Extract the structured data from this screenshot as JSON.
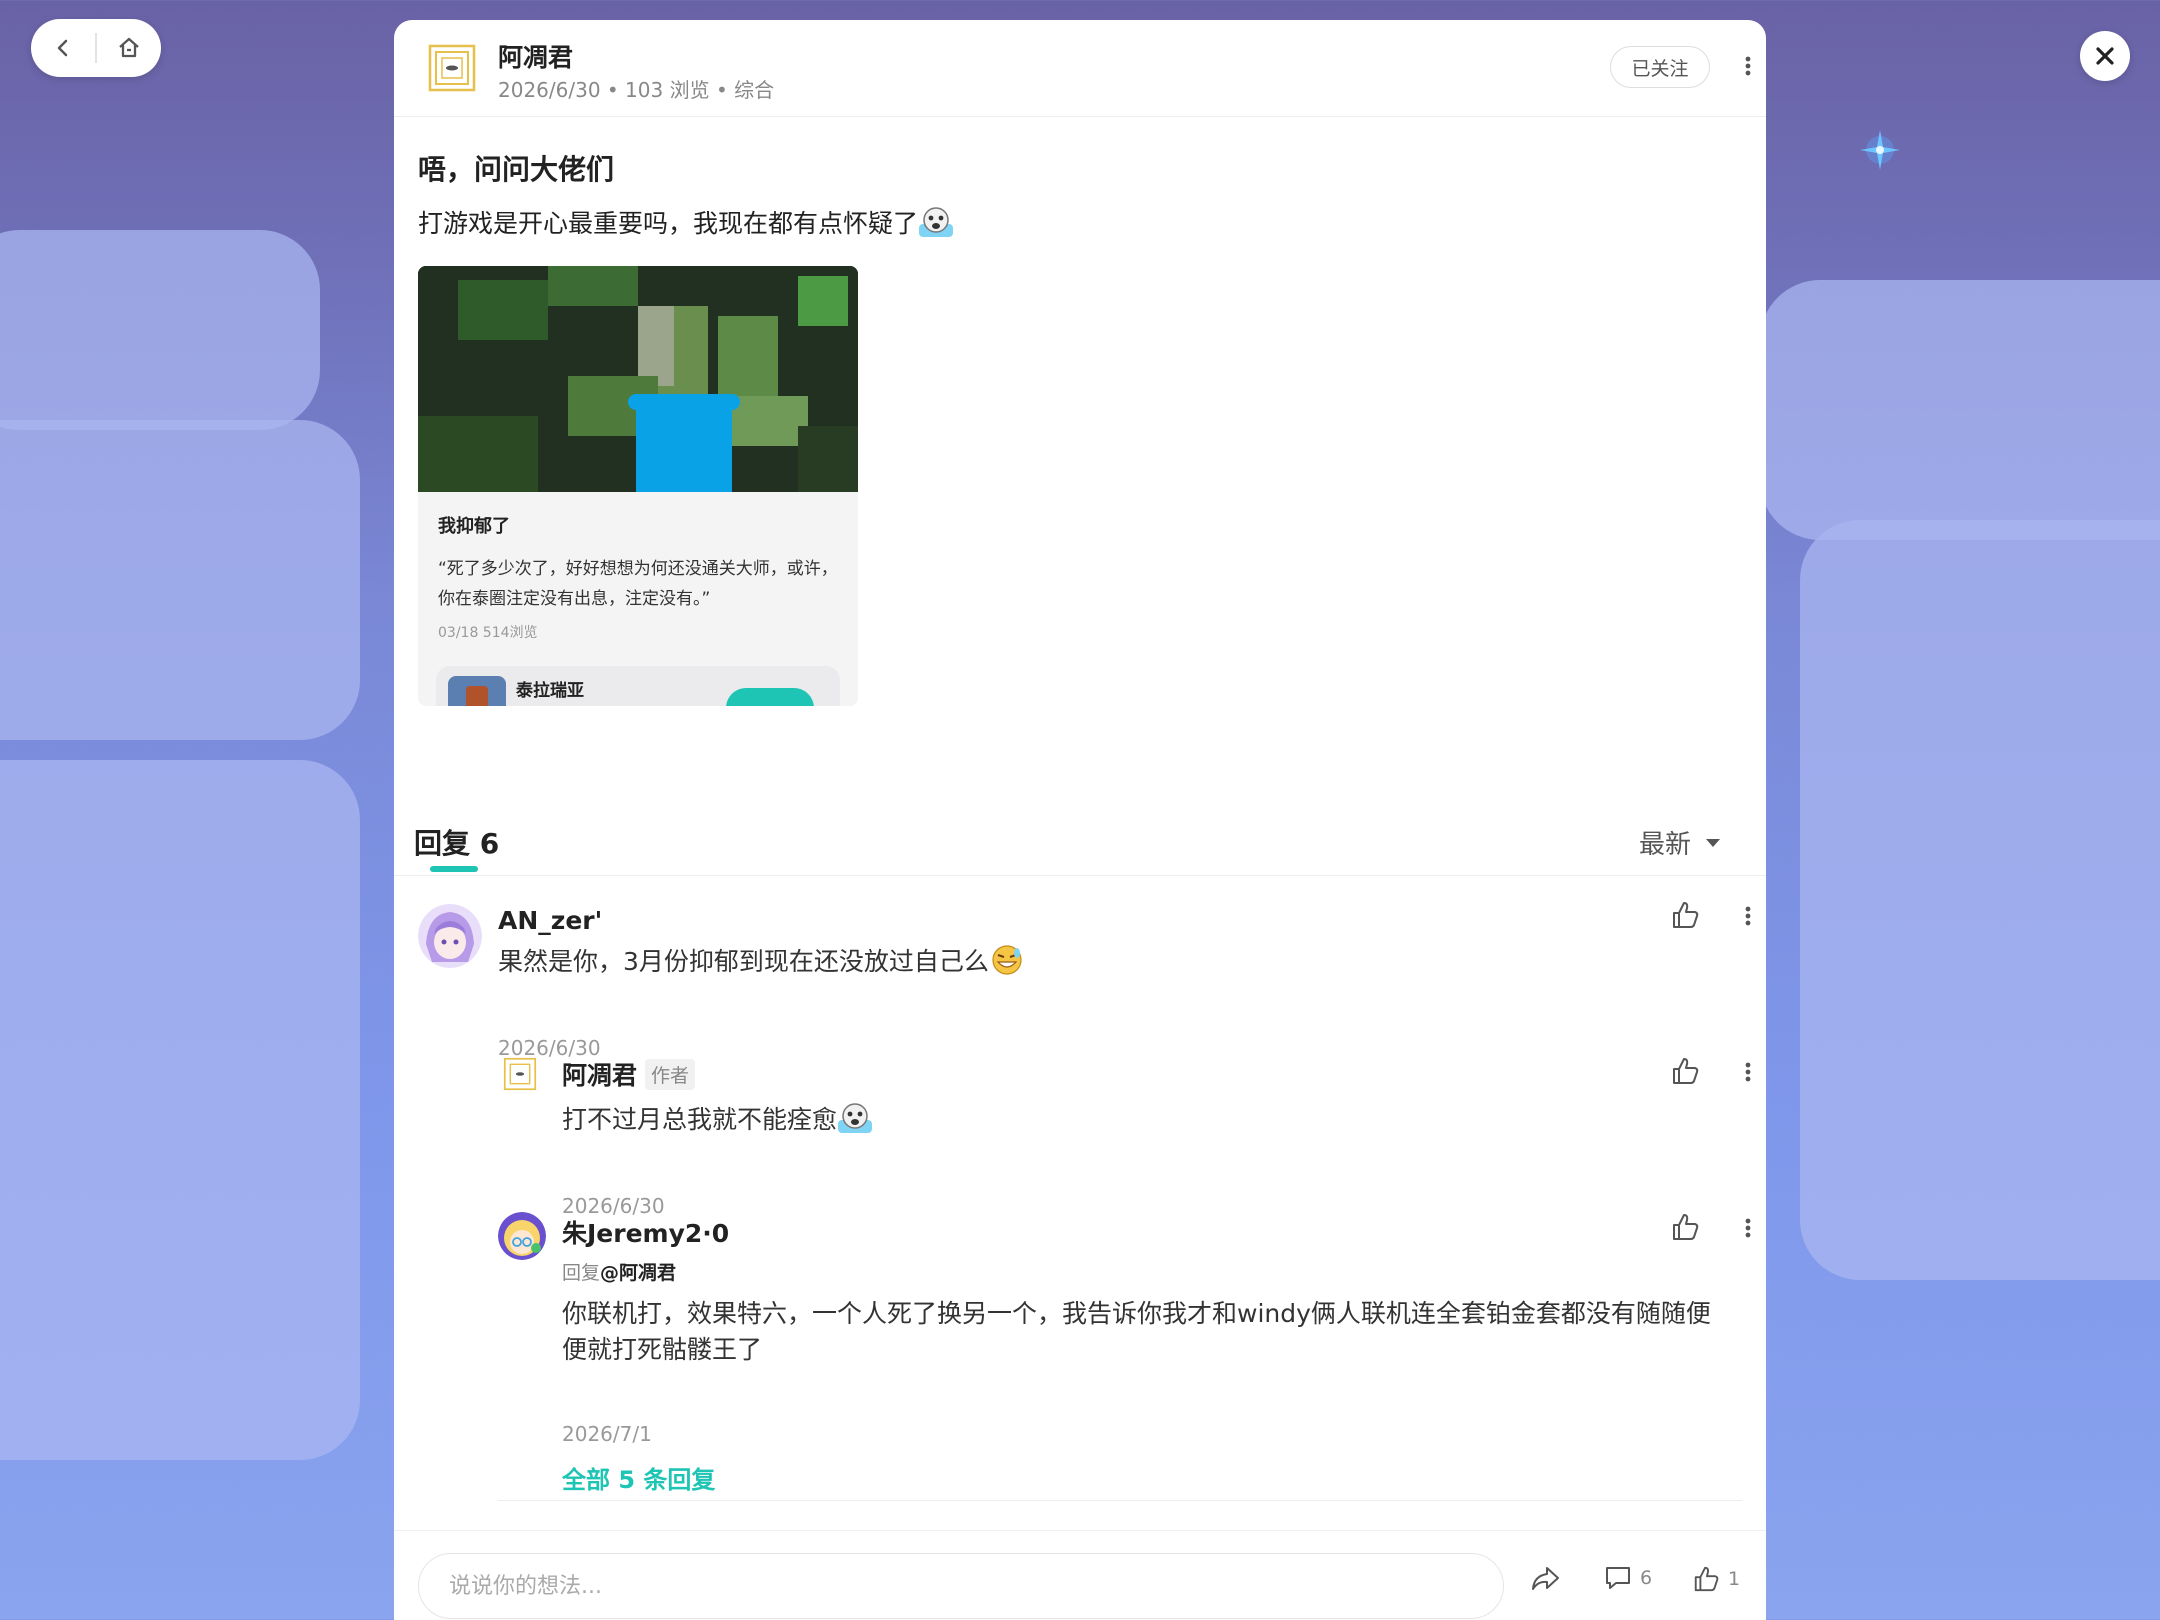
{
  "post": {
    "author": "阿凋君",
    "meta": "2026/6/30 • 103 浏览 • 综合",
    "follow_label": "已关注",
    "title": "唔，问问大佬们",
    "body": "打游戏是开心最重要吗，我现在都有点怀疑了",
    "embed": {
      "title": "我抑郁了",
      "text": "“死了多少次了，好好想想为何还没通关大师，或许，你在泰圈注定没有出息，注定没有。”",
      "meta": "03/18  514浏览",
      "game_name": "泰拉瑞亚"
    }
  },
  "replies": {
    "title": "回复 6",
    "sort_label": "最新"
  },
  "comments": [
    {
      "name": "AN_zer'",
      "text": "果然是你，3月份抑郁到现在还没放过自己么",
      "date": "2026/6/30"
    },
    {
      "name": "阿凋君",
      "tag": "作者",
      "text": "打不过月总我就不能痊愈",
      "date": "2026/6/30"
    },
    {
      "name": "朱Jeremy2·0",
      "reply_prefix": "回复",
      "reply_to": "@阿凋君",
      "text": "你联机打，效果特六，一个人死了换另一个，我告诉你我才和windy俩人联机连全套铂金套都没有随随便便就打死骷髅王了",
      "date": "2026/7/1"
    }
  ],
  "view_all_label": "全部 5 条回复",
  "bottom_bar": {
    "input_placeholder": "说说你的想法...",
    "comment_count": "6",
    "like_count": "1"
  },
  "colors": {
    "accent": "#1ec4b4",
    "background_top": "#6a62a6",
    "background_bottom": "#8aa4ef"
  }
}
